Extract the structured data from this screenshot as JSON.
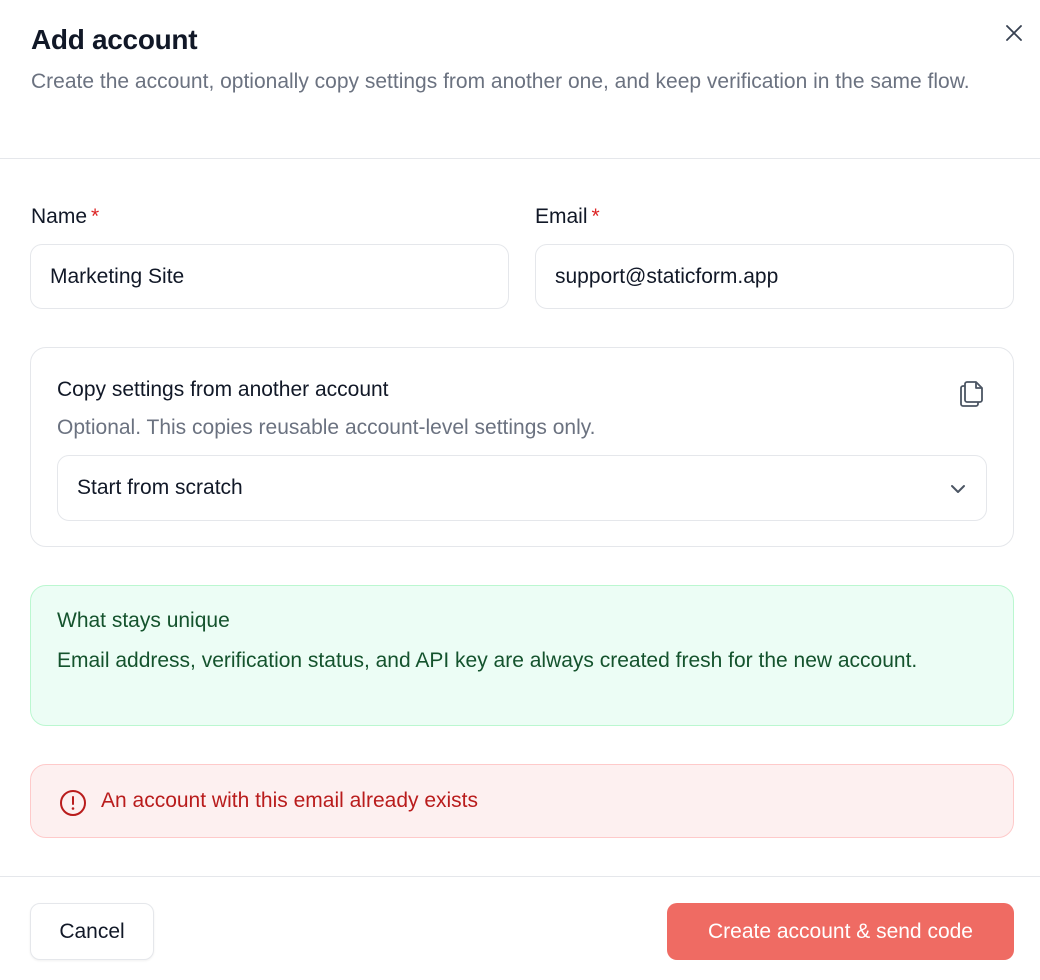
{
  "dialog": {
    "title": "Add account",
    "subtitle": "Create the account, optionally copy settings from another one, and keep verification in the same flow.",
    "close_icon": "close-icon"
  },
  "form": {
    "name": {
      "label": "Name",
      "required_mark": "*",
      "value": "Marketing Site"
    },
    "email": {
      "label": "Email",
      "required_mark": "*",
      "value": "support@staticform.app"
    }
  },
  "copy_settings": {
    "title": "Copy settings from another account",
    "description": "Optional. This copies reusable account-level settings only.",
    "icon": "copy-icon",
    "select_value": "Start from scratch"
  },
  "info": {
    "title": "What stays unique",
    "text": "Email address, verification status, and API key are always created fresh for the new account."
  },
  "error": {
    "icon": "alert-circle-icon",
    "message": "An account with this email already exists"
  },
  "footer": {
    "cancel_label": "Cancel",
    "submit_label": "Create account & send code"
  },
  "colors": {
    "primary_button": "#ef6b63",
    "error_text": "#b91c1c",
    "error_bg": "#fdf0f0",
    "success_text": "#14532d",
    "success_bg": "#ecfdf5",
    "required": "#dc2626"
  }
}
